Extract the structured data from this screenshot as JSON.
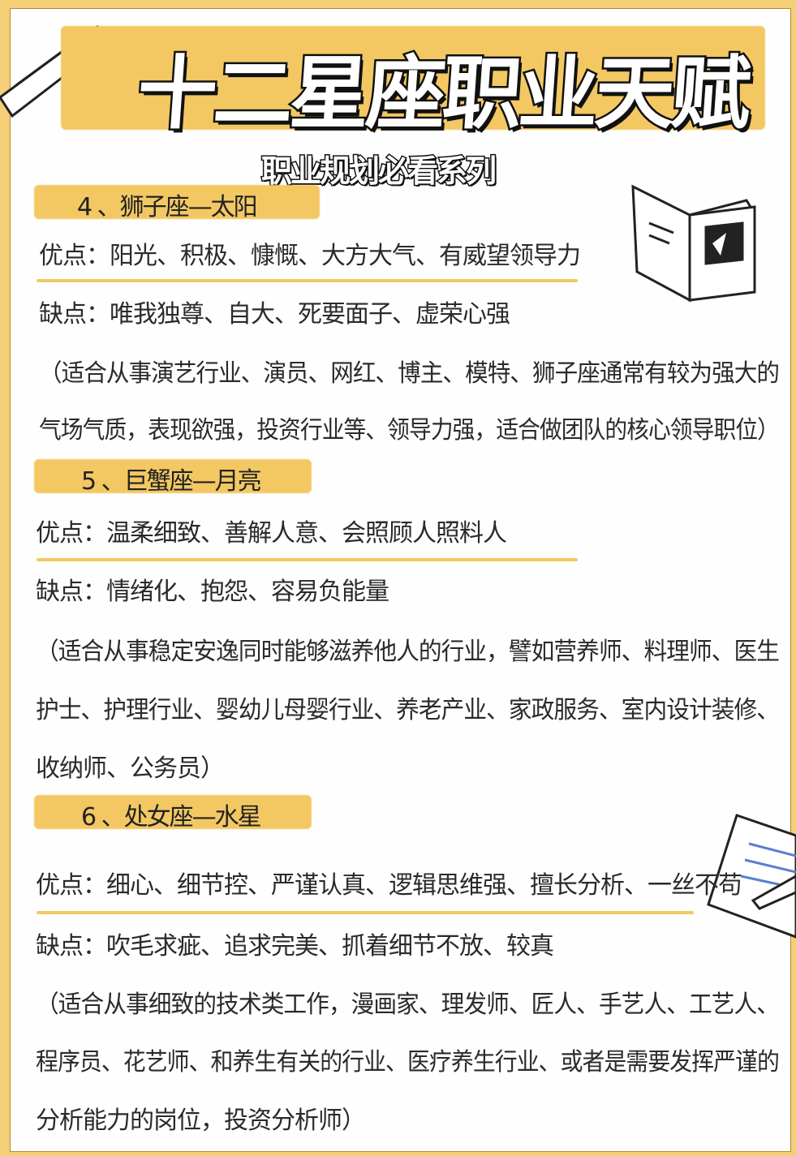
{
  "title": "十二星座职业天赋",
  "subtitle": "职业规划必看系列",
  "sections": [
    {
      "header": "4 、狮子座—太阳",
      "pros": "优点：阳光、积极、慷慨、大方大气、有威望领导力",
      "cons": "缺点：唯我独尊、自大、死要面子、虚荣心强",
      "careers": [
        "（适合从事演艺行业、演员、网红、博主、模特、狮子座通常有较为强大的",
        "气场气质，表现欲强，投资行业等、领导力强，适合做团队的核心领导职位）"
      ]
    },
    {
      "header": "5 、巨蟹座—月亮",
      "pros": "优点：温柔细致、善解人意、会照顾人照料人",
      "cons": "缺点：情绪化、抱怨、容易负能量",
      "careers": [
        "（适合从事稳定安逸同时能够滋养他人的行业，譬如营养师、料理师、医生",
        "护士、护理行业、婴幼儿母婴行业、养老产业、家政服务、室内设计装修、",
        "收纳师、公务员）"
      ]
    },
    {
      "header": "6 、处女座—水星",
      "pros": "优点：细心、细节控、严谨认真、逻辑思维强、擅长分析、一丝不苟",
      "cons": "缺点：吹毛求疵、追求完美、抓着细节不放、较真",
      "careers": [
        "（适合从事细致的技术类工作，漫画家、理发师、匠人、手艺人、工艺人、",
        "程序员、花艺师、和养生有关的行业、医疗养生行业、或者是需要发挥严谨的",
        "分析能力的岗位，投资分析师）"
      ]
    }
  ],
  "colors": {
    "accent": "#f3c863",
    "frame": "#f4cf78",
    "text": "#2a2a2a"
  }
}
